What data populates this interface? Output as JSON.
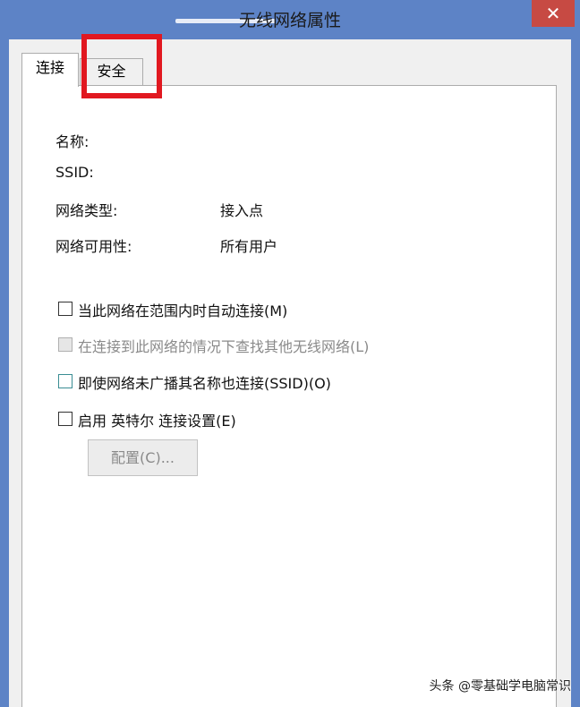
{
  "window": {
    "title": "无线网络属性",
    "close_glyph": "✕"
  },
  "tabs": [
    {
      "label": "连接",
      "selected": true
    },
    {
      "label": "安全",
      "selected": false
    }
  ],
  "info": {
    "name_label": "名称:",
    "name_value": "",
    "ssid_label": "SSID:",
    "ssid_value": "",
    "type_label": "网络类型:",
    "type_value": "接入点",
    "availability_label": "网络可用性:",
    "availability_value": "所有用户"
  },
  "options": [
    {
      "label": "当此网络在范围内时自动连接(M)",
      "checked": false,
      "enabled": true
    },
    {
      "label": "在连接到此网络的情况下查找其他无线网络(L)",
      "checked": false,
      "enabled": false
    },
    {
      "label": "即使网络未广播其名称也连接(SSID)(O)",
      "checked": false,
      "enabled": true
    },
    {
      "label": "启用 英特尔 连接设置(E)",
      "checked": false,
      "enabled": true
    }
  ],
  "config_button": {
    "label": "配置(C)...",
    "enabled": false
  },
  "watermark": "头条 @零基础学电脑常识",
  "colors": {
    "frame": "#5d83c6",
    "close_button": "#c74a43",
    "highlight_box": "#e11820",
    "panel": "#ffffff",
    "client": "#f0f0f0"
  }
}
